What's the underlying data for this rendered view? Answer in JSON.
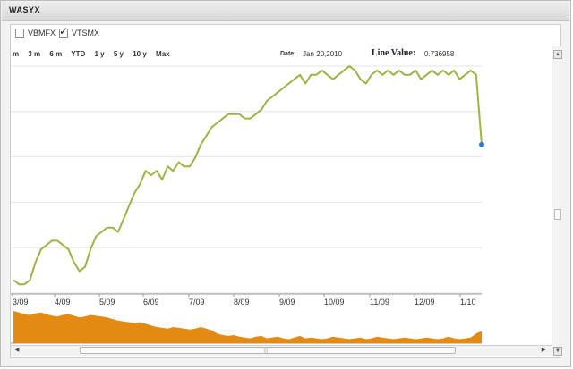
{
  "window": {
    "title": "WASYX"
  },
  "legend": [
    {
      "label": "VBMFX",
      "checked": false
    },
    {
      "label": "VTSMX",
      "checked": true
    }
  ],
  "zoom": [
    "m",
    "3 m",
    "6 m",
    "YTD",
    "1 y",
    "5 y",
    "10 y",
    "Max"
  ],
  "tooltip": {
    "date_label": "Date:",
    "date_value": "Jan 20,2010",
    "line_value_label": "Line Value:",
    "line_value": "0.736958"
  },
  "colors": {
    "line": "#9bb347",
    "volume": "#e38a12",
    "marker": "#2f77d0",
    "grid": "#e4e4e4"
  },
  "chart_data": {
    "type": "line",
    "series": [
      {
        "name": "VTSMX",
        "values": [
          0.43,
          0.42,
          0.42,
          0.43,
          0.47,
          0.5,
          0.51,
          0.52,
          0.52,
          0.51,
          0.5,
          0.47,
          0.45,
          0.46,
          0.5,
          0.53,
          0.54,
          0.55,
          0.55,
          0.54,
          0.57,
          0.6,
          0.63,
          0.65,
          0.68,
          0.67,
          0.68,
          0.66,
          0.69,
          0.68,
          0.7,
          0.69,
          0.69,
          0.71,
          0.74,
          0.76,
          0.78,
          0.79,
          0.8,
          0.81,
          0.81,
          0.81,
          0.8,
          0.8,
          0.81,
          0.82,
          0.84,
          0.85,
          0.86,
          0.87,
          0.88,
          0.89,
          0.9,
          0.88,
          0.9,
          0.9,
          0.91,
          0.9,
          0.89,
          0.9,
          0.91,
          0.92,
          0.91,
          0.89,
          0.88,
          0.9,
          0.91,
          0.9,
          0.91,
          0.9,
          0.91,
          0.9,
          0.9,
          0.91,
          0.89,
          0.9,
          0.91,
          0.9,
          0.91,
          0.9,
          0.91,
          0.89,
          0.9,
          0.91,
          0.9,
          0.74
        ]
      }
    ],
    "x_tick_labels": [
      "3/09",
      "4/09",
      "5/09",
      "6/09",
      "7/09",
      "8/09",
      "9/09",
      "10/09",
      "11/09",
      "12/09",
      "1/10"
    ],
    "y_range": [
      0.4,
      0.92
    ],
    "grid": true,
    "volume": [
      0.4,
      0.38,
      0.36,
      0.35,
      0.37,
      0.38,
      0.36,
      0.34,
      0.33,
      0.35,
      0.36,
      0.34,
      0.32,
      0.33,
      0.35,
      0.34,
      0.33,
      0.32,
      0.3,
      0.28,
      0.27,
      0.26,
      0.25,
      0.26,
      0.24,
      0.22,
      0.2,
      0.19,
      0.18,
      0.2,
      0.19,
      0.18,
      0.17,
      0.18,
      0.2,
      0.18,
      0.16,
      0.12,
      0.1,
      0.09,
      0.1,
      0.08,
      0.07,
      0.06,
      0.08,
      0.09,
      0.06,
      0.07,
      0.08,
      0.06,
      0.05,
      0.07,
      0.09,
      0.06,
      0.07,
      0.06,
      0.05,
      0.06,
      0.08,
      0.07,
      0.06,
      0.05,
      0.06,
      0.07,
      0.05,
      0.06,
      0.08,
      0.07,
      0.06,
      0.05,
      0.06,
      0.07,
      0.06,
      0.05,
      0.06,
      0.07,
      0.06,
      0.05,
      0.06,
      0.08,
      0.06,
      0.05,
      0.06,
      0.07,
      0.12,
      0.15
    ]
  }
}
